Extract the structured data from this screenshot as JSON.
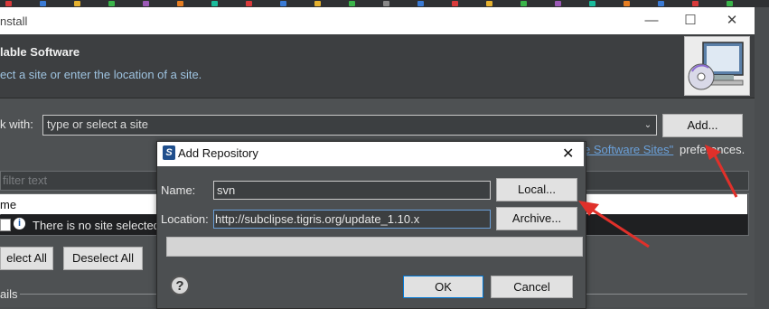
{
  "taskbar": {
    "dots": [
      "#d83a3a",
      "#3a7bd5",
      "#e5b12e",
      "#3ab54a",
      "#9b59b6",
      "#e67e22",
      "#1abc9c",
      "#d83a3a",
      "#3a7bd5",
      "#e5b12e",
      "#3ab54a",
      "#888888",
      "#3a7bd5",
      "#d83a3a",
      "#e5b12e",
      "#3ab54a",
      "#9b59b6",
      "#1abc9c",
      "#e67e22",
      "#3a7bd5",
      "#d83a3a",
      "#3ab54a"
    ]
  },
  "install_window": {
    "title": "nstall",
    "controls": {
      "minimize": "—",
      "maximize": "☐",
      "close": "✕"
    },
    "header_title": "lable Software",
    "header_subtitle": "ect a site or enter the location of a site.",
    "work_with_label": "k with:",
    "site_combo_value": "type or select a site",
    "add_button": "Add...",
    "available_sites_link": "e Software Sites\"",
    "preferences_text": "preferences.",
    "filter_placeholder": "filter text",
    "tree_header": "me",
    "tree_row_text": "There is no site selected.",
    "select_all_button": "elect All",
    "deselect_all_button": "Deselect All",
    "details_label": "ails"
  },
  "dialog": {
    "title": "Add Repository",
    "close": "✕",
    "name_label": "Name:",
    "name_value": "svn",
    "local_button": "Local...",
    "location_label": "Location:",
    "location_value": "http://subclipse.tigris.org/update_1.10.x",
    "archive_button": "Archive...",
    "help_icon": "?",
    "ok_button": "OK",
    "cancel_button": "Cancel"
  },
  "colors": {
    "annotation_arrow": "#e0302a",
    "accent": "#0078d7"
  }
}
